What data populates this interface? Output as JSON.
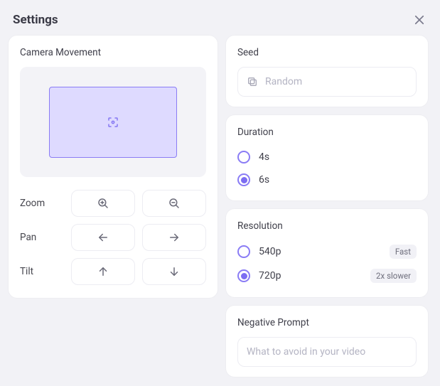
{
  "header": {
    "title": "Settings"
  },
  "camera": {
    "title": "Camera Movement",
    "controls": {
      "zoom_label": "Zoom",
      "pan_label": "Pan",
      "tilt_label": "Tilt"
    }
  },
  "seed": {
    "title": "Seed",
    "placeholder": "Random",
    "value": ""
  },
  "duration": {
    "title": "Duration",
    "options": [
      {
        "label": "4s",
        "selected": false
      },
      {
        "label": "6s",
        "selected": true
      }
    ]
  },
  "resolution": {
    "title": "Resolution",
    "options": [
      {
        "label": "540p",
        "badge": "Fast",
        "selected": false
      },
      {
        "label": "720p",
        "badge": "2x slower",
        "selected": true
      }
    ]
  },
  "negative_prompt": {
    "title": "Negative Prompt",
    "placeholder": "What to avoid in your video",
    "value": ""
  }
}
